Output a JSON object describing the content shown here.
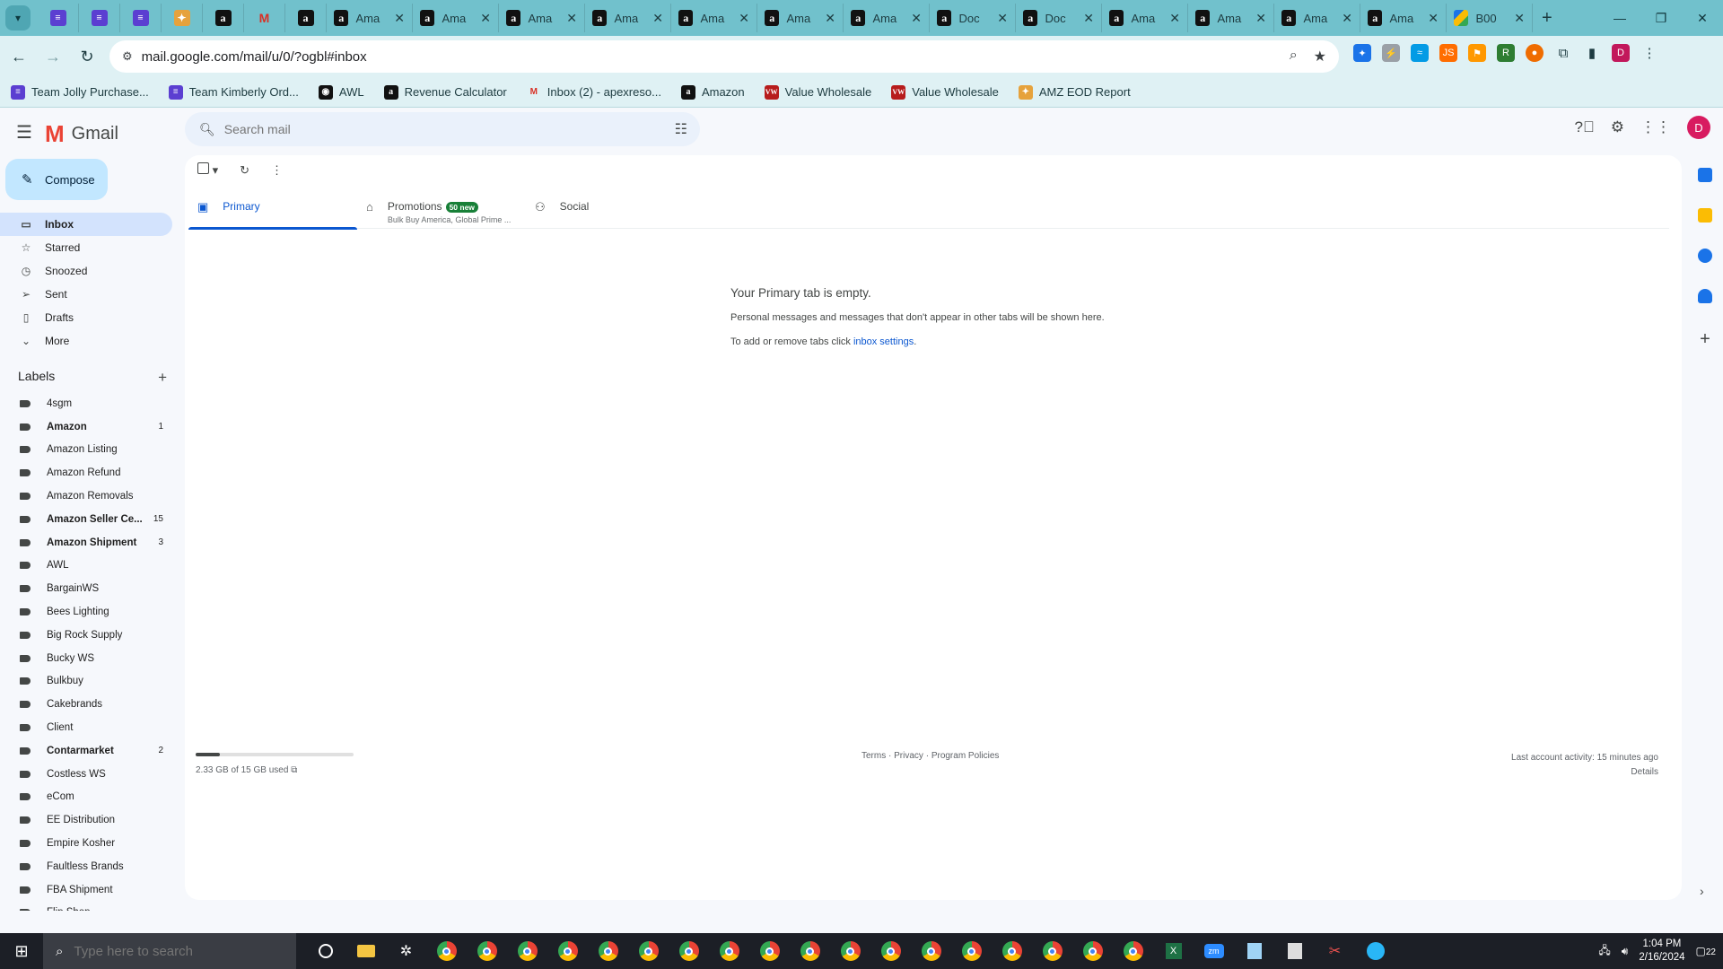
{
  "browser": {
    "tabs": [
      {
        "title": "",
        "icon": "sheet-icon"
      },
      {
        "title": "",
        "icon": "sheet-icon"
      },
      {
        "title": "",
        "icon": "sheet-icon"
      },
      {
        "title": "",
        "icon": "ai-icon"
      },
      {
        "title": "",
        "icon": "amazon-icon"
      },
      {
        "title": "",
        "icon": "gmail-icon",
        "active": true
      },
      {
        "title": "",
        "icon": "amazon-icon"
      },
      {
        "title": "Ama",
        "icon": "amazon-icon"
      },
      {
        "title": "Ama",
        "icon": "amazon-icon"
      },
      {
        "title": "Ama",
        "icon": "amazon-icon"
      },
      {
        "title": "Ama",
        "icon": "amazon-icon"
      },
      {
        "title": "Ama",
        "icon": "amazon-icon"
      },
      {
        "title": "Ama",
        "icon": "amazon-icon"
      },
      {
        "title": "Ama",
        "icon": "amazon-icon"
      },
      {
        "title": "Doc",
        "icon": "amazon-icon"
      },
      {
        "title": "Doc",
        "icon": "amazon-icon"
      },
      {
        "title": "Ama",
        "icon": "amazon-icon"
      },
      {
        "title": "Ama",
        "icon": "amazon-icon"
      },
      {
        "title": "Ama",
        "icon": "amazon-icon"
      },
      {
        "title": "Ama",
        "icon": "amazon-icon"
      },
      {
        "title": "B00",
        "icon": "drive-icon"
      }
    ],
    "url": "mail.google.com/mail/u/0/?ogbl#inbox",
    "profile_initial": "D",
    "bookmarks": [
      {
        "label": "Team Jolly Purchase...",
        "icon": "sheet-icon"
      },
      {
        "label": "Team Kimberly Ord...",
        "icon": "sheet-icon"
      },
      {
        "label": "AWL",
        "icon": "globe-icon"
      },
      {
        "label": "Revenue Calculator",
        "icon": "amazon-icon"
      },
      {
        "label": "Inbox (2) - apexreso...",
        "icon": "gmail-icon"
      },
      {
        "label": "Amazon",
        "icon": "amazon-icon"
      },
      {
        "label": "Value Wholesale",
        "icon": "vw-icon"
      },
      {
        "label": "Value Wholesale",
        "icon": "vw-icon"
      },
      {
        "label": "AMZ EOD Report",
        "icon": "ai-icon"
      }
    ]
  },
  "gmail": {
    "app_name": "Gmail",
    "search_placeholder": "Search mail",
    "avatar_initial": "D",
    "compose_label": "Compose",
    "nav": [
      {
        "label": "Inbox",
        "icon": "inbox-icon",
        "active": true
      },
      {
        "label": "Starred",
        "icon": "star-icon"
      },
      {
        "label": "Snoozed",
        "icon": "clock-icon"
      },
      {
        "label": "Sent",
        "icon": "send-icon"
      },
      {
        "label": "Drafts",
        "icon": "draft-icon"
      },
      {
        "label": "More",
        "icon": "chevron-down-icon"
      }
    ],
    "labels_heading": "Labels",
    "labels": [
      {
        "name": "4sgm",
        "count": "",
        "bold": false
      },
      {
        "name": "Amazon",
        "count": "1",
        "bold": true
      },
      {
        "name": "Amazon Listing",
        "count": "",
        "bold": false
      },
      {
        "name": "Amazon Refund",
        "count": "",
        "bold": false
      },
      {
        "name": "Amazon Removals",
        "count": "",
        "bold": false
      },
      {
        "name": "Amazon Seller Ce...",
        "count": "15",
        "bold": true
      },
      {
        "name": "Amazon Shipment",
        "count": "3",
        "bold": true
      },
      {
        "name": "AWL",
        "count": "",
        "bold": false
      },
      {
        "name": "BargainWS",
        "count": "",
        "bold": false
      },
      {
        "name": "Bees Lighting",
        "count": "",
        "bold": false
      },
      {
        "name": "Big Rock Supply",
        "count": "",
        "bold": false
      },
      {
        "name": "Bucky WS",
        "count": "",
        "bold": false
      },
      {
        "name": "Bulkbuy",
        "count": "",
        "bold": false
      },
      {
        "name": "Cakebrands",
        "count": "",
        "bold": false
      },
      {
        "name": "Client",
        "count": "",
        "bold": false
      },
      {
        "name": "Contarmarket",
        "count": "2",
        "bold": true
      },
      {
        "name": "Costless WS",
        "count": "",
        "bold": false
      },
      {
        "name": "eCom",
        "count": "",
        "bold": false
      },
      {
        "name": "EE Distribution",
        "count": "",
        "bold": false
      },
      {
        "name": "Empire Kosher",
        "count": "",
        "bold": false
      },
      {
        "name": "Faultless Brands",
        "count": "",
        "bold": false
      },
      {
        "name": "FBA Shipment",
        "count": "",
        "bold": false
      },
      {
        "name": "Flip Shop",
        "count": "",
        "bold": false
      }
    ],
    "tabs": {
      "primary": "Primary",
      "promotions": "Promotions",
      "promotions_badge": "50 new",
      "promotions_sub": "Bulk Buy America, Global Prime ...",
      "social": "Social"
    },
    "empty": {
      "heading": "Your Primary tab is empty.",
      "line1": "Personal messages and messages that don't appear in other tabs will be shown here.",
      "line2_prefix": "To add or remove tabs click ",
      "line2_link": "inbox settings",
      "line2_suffix": "."
    },
    "footer": {
      "storage_text": "2.33 GB of 15 GB used",
      "storage_fraction": 0.155,
      "terms": "Terms",
      "privacy": "Privacy",
      "policies": "Program Policies",
      "sep": " · ",
      "activity": "Last account activity: 15 minutes ago",
      "details": "Details"
    }
  },
  "taskbar": {
    "search_placeholder": "Type here to search",
    "time": "1:04 PM",
    "date": "2/16/2024",
    "notifications": "22"
  },
  "colors": {
    "tabstrip": "#71c1cc",
    "toolbar": "#dff1f4",
    "compose": "#c2e7ff",
    "active_nav": "#d3e3fd",
    "link": "#0b57d0",
    "badge": "#188038"
  }
}
